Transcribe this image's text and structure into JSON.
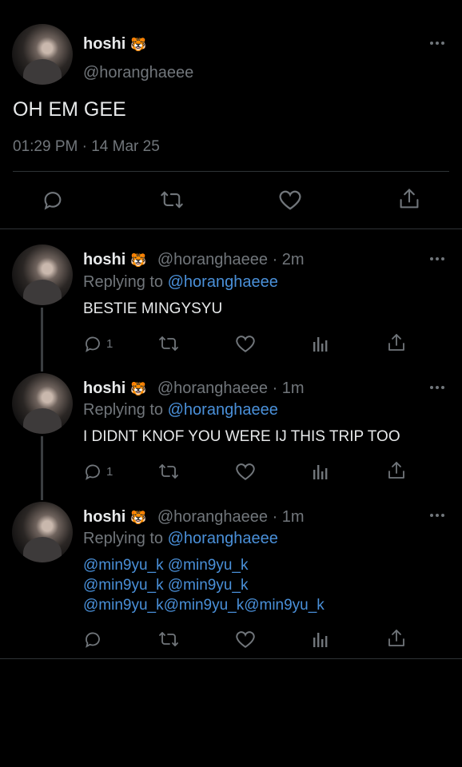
{
  "main_tweet": {
    "name": "hoshi",
    "emoji": "🐯",
    "handle": "@horanghaeee",
    "text": "OH EM GEE",
    "timestamp": "01:29 PM · 14 Mar 25",
    "actions": [
      "reply-icon",
      "retweet-icon",
      "like-icon",
      "share-icon"
    ]
  },
  "replies": [
    {
      "name": "hoshi",
      "emoji": "🐯",
      "handle_time": "@horanghaeee · 2m",
      "replying_prefix": "Replying to",
      "replying_to": "@horanghaeee",
      "text": "BESTIE MINGYSYU",
      "reply_count": "1"
    },
    {
      "name": "hoshi",
      "emoji": "🐯",
      "handle_time": "@horanghaeee · 1m",
      "replying_prefix": "Replying to",
      "replying_to": "@horanghaeee",
      "text": "I DIDNT KNOF YOU WERE IJ THIS TRIP TOO",
      "reply_count": "1"
    },
    {
      "name": "hoshi",
      "emoji": "🐯",
      "handle_time": "@horanghaeee · 1m",
      "replying_prefix": "Replying to",
      "replying_to": "@horanghaeee",
      "mention_lines": [
        "@min9yu_k @min9yu_k",
        "@min9yu_k @min9yu_k",
        "@min9yu_k@min9yu_k@min9yu_k"
      ],
      "reply_count": ""
    }
  ],
  "colors": {
    "background": "#000000",
    "text": "#e7e9ea",
    "secondary": "#71767b",
    "link": "#4a90d9",
    "divider": "#2f3336"
  }
}
